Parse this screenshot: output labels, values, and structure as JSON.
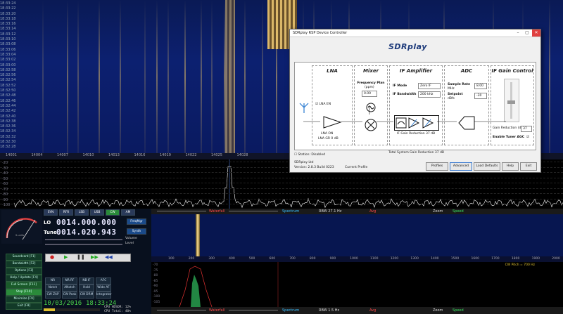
{
  "waterfall": {
    "times": [
      "18:33:24",
      "18:33:22",
      "18:33:20",
      "18:33:18",
      "18:33:16",
      "18:33:14",
      "18:33:12",
      "18:33:10",
      "18:33:08",
      "18:33:06",
      "18:33:04",
      "18:33:02",
      "18:33:00",
      "18:32:58",
      "18:32:56",
      "18:32:54",
      "18:32:52",
      "18:32:50",
      "18:32:48",
      "18:32:46",
      "18:32:44",
      "18:32:42",
      "18:32:40",
      "18:32:38",
      "18:32:36",
      "18:32:34",
      "18:32:32",
      "18:32:30",
      "18:32:28"
    ],
    "freq_ticks": [
      "14001",
      "14004",
      "14007",
      "14010",
      "14013",
      "14016",
      "14019",
      "14022",
      "14025",
      "14028"
    ]
  },
  "spectrum": {
    "y_labels": [
      "-20",
      "-30",
      "-40",
      "-50",
      "-60",
      "-70",
      "-80",
      "-90",
      "-100"
    ]
  },
  "dialog": {
    "title": "SDRplay RSP Device Controller",
    "logo": "SDRplay",
    "blocks": {
      "lna": "LNA",
      "mixer": "Mixer",
      "if_amp": "IF Amplifier",
      "adc": "ADC",
      "if_gain": "IF Gain Control"
    },
    "lna_en": "LNA EN",
    "lna_on": "LNA ON",
    "lna_gr": "LNA GR 0 dB",
    "freq_span_label": "Frequency Plan",
    "freq_span_unit": "(ppm)",
    "freq_span_value": "0.00",
    "if_mode_label": "IF Mode",
    "if_mode_value": "Zero IF",
    "if_bw_label": "IF Bandwidth",
    "if_bw_value": "200 kHz",
    "if_gain_reduction": "IF Gain Reduction 37 dB",
    "sample_rate_label": "Sample Rate",
    "sample_rate_unit": "MHz",
    "sample_rate_value": "8.00",
    "setpoint_label": "Setpoint",
    "setpoint_unit": "dBfs",
    "setpoint_value": "-30",
    "gain_reduction_label": "Gain Reduction (dB)",
    "gain_reduction_value": "37",
    "enable_agc": "Enable Tuner AGC",
    "total_gain": "Total System Gain Reduction 37 dB",
    "station": "Station: Disabled",
    "company": "SDRplay Ltd",
    "version": "Version: 2.8.3 Build 0223",
    "current_profile": "Current Profile",
    "buttons": [
      "Profiles",
      "Advanced",
      "Load Defaults",
      "Help",
      "Exit"
    ]
  },
  "bar": {
    "waterfall": "Waterfall",
    "spectrum": "Spectrum",
    "rbw1": "RBW 27.1 Hz",
    "rbw2": "RBW 1.5 Hz",
    "avg": "Avg",
    "zoom": "Zoom",
    "speed": "Speed"
  },
  "controls": {
    "lo_label": "LO",
    "lo_value": "0014.000.000",
    "tune_label": "Tune",
    "tune_value": "0014.020.943",
    "freqmgr": "FreqMgr",
    "synth": "Synth",
    "volume": "Volume",
    "level": "Level",
    "mode_buttons": [
      "SYN",
      "RFR",
      "LSB",
      "USB",
      "CW",
      "AM"
    ],
    "fkeys": [
      "Soundcard [F1]",
      "Bandwidth [F2]",
      "Options [F3]",
      "Help / Update [F4]",
      "Full Screen [F11]",
      "Stop [F10]",
      "Minimize [F9]",
      "Exit [F8]"
    ],
    "dsp_row1": [
      "NR",
      "NR RF",
      "NB IF",
      "AFC"
    ],
    "dsp_row2": [
      "Notch",
      "ANotch",
      "Hold",
      "Wide AF"
    ],
    "dsp_row3": [
      "CW ZAP",
      "CW Peak",
      "CW DRM",
      "Integrator"
    ],
    "date": "10/03/2016",
    "time": "18:33:24",
    "cpu1": "CPU HDSDR: 12%",
    "cpu2": "CPU Total: 40%",
    "smeter": "S-units"
  },
  "wf2": {
    "ticks": [
      "100",
      "200",
      "300",
      "400",
      "500",
      "600",
      "700",
      "800",
      "900",
      "1000",
      "1100",
      "1200",
      "1300",
      "1400",
      "1500",
      "1600",
      "1700",
      "1800",
      "1900",
      "2000"
    ],
    "label": "CW Pitch = 700 Hz"
  },
  "spec2": {
    "y_labels": [
      "-70",
      "-75",
      "-80",
      "-85",
      "-90",
      "-95",
      "-100",
      "-105"
    ]
  },
  "colors": {
    "waterfall_bg": "#0c2070",
    "signal": "#ffd26a",
    "spectrum_line": "#ffffff",
    "red_trace": "#e03030",
    "green_trace": "#30c060",
    "dialog_bg": "#f0f0f0"
  }
}
